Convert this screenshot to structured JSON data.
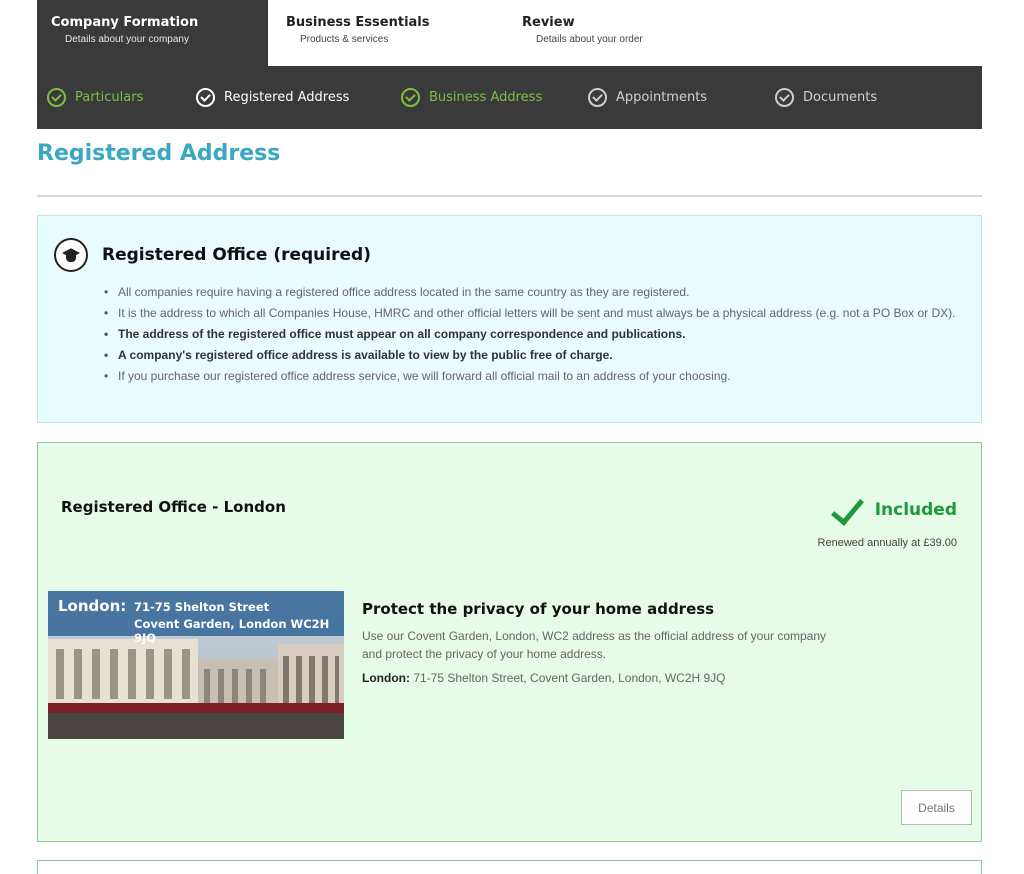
{
  "steps": [
    {
      "title": "Company Formation",
      "subtitle": "Details about your company"
    },
    {
      "title": "Business Essentials",
      "subtitle": "Products & services"
    },
    {
      "title": "Review",
      "subtitle": "Details about your order"
    }
  ],
  "substeps": [
    {
      "label": "Particulars",
      "state": "complete"
    },
    {
      "label": "Registered Address",
      "state": "current"
    },
    {
      "label": "Business Address",
      "state": "complete"
    },
    {
      "label": "Appointments",
      "state": "pending"
    },
    {
      "label": "Documents",
      "state": "pending"
    }
  ],
  "page_title": "Registered Address",
  "info": {
    "icon": "graduation-cap-icon",
    "title": "Registered Office (required)",
    "bullets": [
      {
        "text": "All companies require having a registered office address located in the same country as they are registered.",
        "bold": false
      },
      {
        "text": "It is the address to which all Companies House, HMRC and other official letters will be sent and must always be a physical address (e.g. not a PO Box or DX).",
        "bold": false
      },
      {
        "text": "The address of the registered office must appear on all company correspondence and publications.",
        "bold": true
      },
      {
        "text": "A company's registered office address is available to view by the public free of charge.",
        "bold": true
      },
      {
        "text": "If you purchase our registered office address service, we will forward all official mail to an address of your choosing.",
        "bold": false
      }
    ]
  },
  "product": {
    "name": "Registered Office - London",
    "status": "Included",
    "renewal": "Renewed annually at £39.00",
    "photo": {
      "city": "London:",
      "address_line1": "71-75 Shelton Street",
      "address_line2": "Covent Garden, London WC2H 9JQ"
    },
    "promo_title": "Protect the privacy of your home address",
    "promo_text": "Use our Covent Garden, London, WC2 address as the official address of your company and protect the privacy of your home address.",
    "address_label": "London:",
    "address_value": " 71-75 Shelton Street, Covent Garden, London, WC2H 9JQ",
    "details_label": "Details"
  },
  "colors": {
    "accent_blue": "#3aa8c1",
    "complete_green": "#7ac043",
    "included_green": "#1e9a3a",
    "nav_dark": "#3a3a3a"
  }
}
